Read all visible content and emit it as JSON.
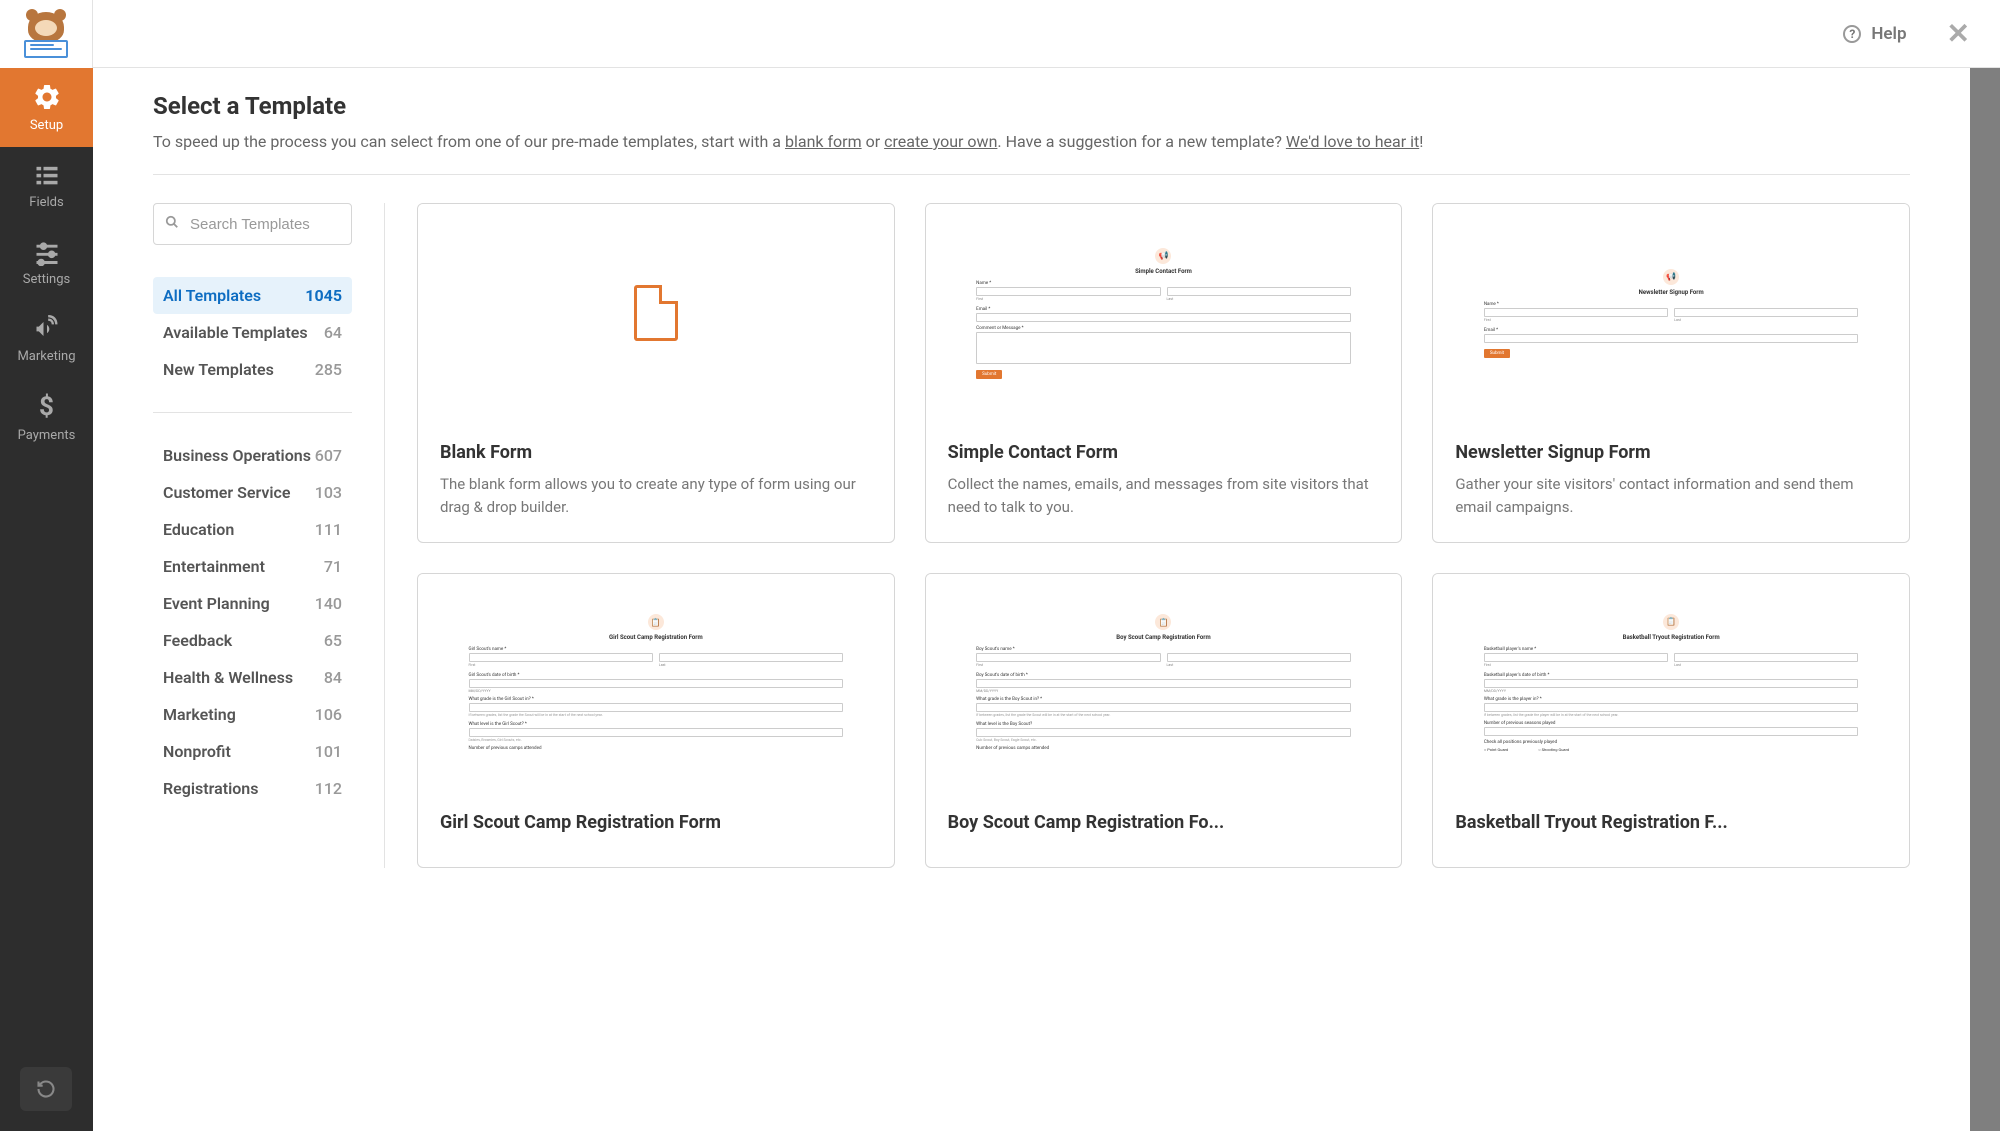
{
  "sidebar": {
    "items": [
      {
        "label": "Setup",
        "icon": "⚙"
      },
      {
        "label": "Fields",
        "icon": "list"
      },
      {
        "label": "Settings",
        "icon": "sliders"
      },
      {
        "label": "Marketing",
        "icon": "📢"
      },
      {
        "label": "Payments",
        "icon": "$"
      }
    ]
  },
  "header": {
    "help_label": "Help"
  },
  "intro": {
    "title": "Select a Template",
    "text_1": "To speed up the process you can select from one of our pre-made templates, start with a ",
    "link_1": "blank form",
    "text_2": " or ",
    "link_2": "create your own",
    "text_3": ". Have a suggestion for a new template? ",
    "link_3": "We'd love to hear it",
    "text_4": "!"
  },
  "search": {
    "placeholder": "Search Templates"
  },
  "top_categories": [
    {
      "label": "All Templates",
      "count": "1045",
      "active": true
    },
    {
      "label": "Available Templates",
      "count": "64"
    },
    {
      "label": "New Templates",
      "count": "285"
    }
  ],
  "categories": [
    {
      "label": "Business Operations",
      "count": "607"
    },
    {
      "label": "Customer Service",
      "count": "103"
    },
    {
      "label": "Education",
      "count": "111"
    },
    {
      "label": "Entertainment",
      "count": "71"
    },
    {
      "label": "Event Planning",
      "count": "140"
    },
    {
      "label": "Feedback",
      "count": "65"
    },
    {
      "label": "Health & Wellness",
      "count": "84"
    },
    {
      "label": "Marketing",
      "count": "106"
    },
    {
      "label": "Nonprofit",
      "count": "101"
    },
    {
      "label": "Registrations",
      "count": "112"
    }
  ],
  "templates": [
    {
      "title": "Blank Form",
      "desc": "The blank form allows you to create any type of form using our drag & drop builder.",
      "preview": "blank"
    },
    {
      "title": "Simple Contact Form",
      "desc": "Collect the names, emails, and messages from site visitors that need to talk to you.",
      "preview": "contact"
    },
    {
      "title": "Newsletter Signup Form",
      "desc": "Gather your site visitors' contact information and send them email campaigns.",
      "preview": "newsletter"
    },
    {
      "title": "Girl Scout Camp Registration Form",
      "desc": "",
      "preview": "girlscout"
    },
    {
      "title": "Boy Scout Camp Registration Fo...",
      "desc": "",
      "preview": "boyscout"
    },
    {
      "title": "Basketball Tryout Registration F...",
      "desc": "",
      "preview": "basketball"
    }
  ],
  "previews": {
    "contact": {
      "title": "Simple Contact Form",
      "l_name": "Name *",
      "l_first": "First",
      "l_last": "Last",
      "l_email": "Email *",
      "l_msg": "Comment or Message *",
      "btn": "Submit"
    },
    "newsletter": {
      "title": "Newsletter Signup Form",
      "l_name": "Name *",
      "l_first": "First",
      "l_last": "Last",
      "l_email": "Email *",
      "btn": "Submit"
    },
    "girlscout": {
      "title": "Girl Scout Camp Registration Form",
      "l1": "Girl Scout's name *",
      "t_first": "First",
      "t_last": "Last",
      "l2": "Girl Scout's date of birth *",
      "ph": "MM/DD/YYYY",
      "l3": "What grade is the Girl Scout in? *",
      "help": "If between grades, list the grade the Scout will be in at the start of the next school year.",
      "l4": "What level is the Girl Scout? *",
      "help2": "Daisies, Brownies, Girl Scouts, etc.",
      "l5": "Number of previous camps attended"
    },
    "boyscout": {
      "title": "Boy Scout Camp Registration Form",
      "l1": "Boy Scout's name *",
      "t_first": "First",
      "t_last": "Last",
      "l2": "Boy Scout's date of birth *",
      "ph": "MM/DD/YYYY",
      "l3": "What grade is the Boy Scout in? *",
      "help": "If between grades, list the grade the Scout will be in at the start of the next school year.",
      "l4": "What level is the Boy Scout?",
      "help2": "Cub Scout, Boy Scout, Eagle Scout, etc.",
      "l5": "Number of previous camps attended"
    },
    "basketball": {
      "title": "Basketball Tryout Registration Form",
      "l1": "Basketball player's name *",
      "t_first": "First",
      "t_last": "Last",
      "l2": "Basketball player's date of birth *",
      "ph": "MM/DD/YYYY",
      "l3": "What grade is the player in? *",
      "help": "If between grades, list the grade the player will be in at the start of the next school year.",
      "l4": "Number of previous seasons played",
      "l5": "Check all positions previously played",
      "r1": "Point Guard",
      "r2": "Shooting Guard"
    }
  }
}
